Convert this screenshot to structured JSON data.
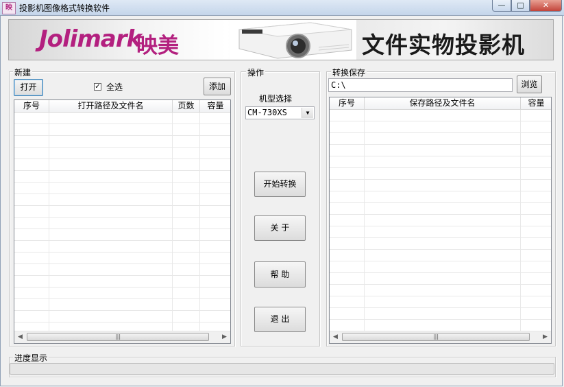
{
  "window": {
    "icon_text": "映",
    "title": "投影机图像格式转换软件",
    "minimize": "—",
    "maximize": "□",
    "close": "✕"
  },
  "banner": {
    "logo": "Jolimark",
    "logo_cn": "映美",
    "title": "文件实物投影机"
  },
  "new_group": {
    "legend": "新建",
    "open_button": "打开",
    "select_all_label": "全选",
    "select_all_checked": "✓",
    "add_button": "添加",
    "columns": [
      "序号",
      "打开路径及文件名",
      "页数",
      "容量"
    ]
  },
  "operation_group": {
    "legend": "操作",
    "model_label": "机型选择",
    "model_value": "CM-730XS",
    "start_button": "开始转换",
    "about_button": "关  于",
    "help_button": "帮  助",
    "exit_button": "退  出"
  },
  "save_group": {
    "legend": "转换保存",
    "path_value": "C:\\",
    "browse_button": "浏览",
    "columns": [
      "序号",
      "保存路径及文件名",
      "容量"
    ]
  },
  "progress_group": {
    "legend": "进度显示",
    "progress": 0
  },
  "scrollbar": {
    "left_arrow": "◀",
    "right_arrow": "▶",
    "thumb_grip": "|||"
  }
}
